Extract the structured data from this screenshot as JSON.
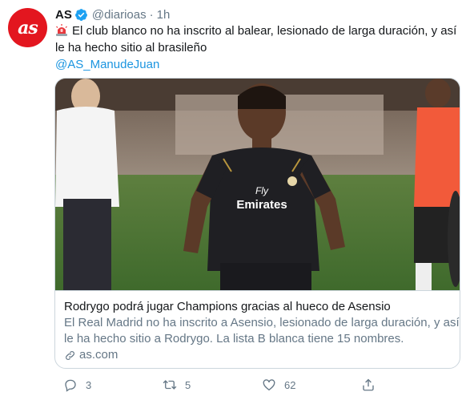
{
  "tweet": {
    "avatar_text": "as",
    "author_name": "AS",
    "handle": "@diarioas",
    "separator": "·",
    "time": "1h",
    "text_line1": "El club blanco no ha inscrito al balear, lesionado de larga duración, y así",
    "text_line2": "le ha hecho sitio al brasileño",
    "mention": "@AS_ManudeJuan",
    "icons": [
      "verified-badge-icon",
      "siren-emoji-icon"
    ],
    "colors": {
      "brand": "#e3161f",
      "verified": "#1da1f2",
      "link": "#1b95e0",
      "muted": "#657786"
    }
  },
  "card": {
    "image_jersey_text_line1": "Fly",
    "image_jersey_text_line2": "Emirates",
    "title": "Rodrygo podrá jugar Champions gracias al hueco de Asensio",
    "desc_line1": "El Real Madrid no ha inscrito a Asensio, lesionado de larga duración, y así",
    "desc_line2": "le ha hecho sitio a Rodrygo. La lista B blanca tiene 15 nombres.",
    "domain": "as.com"
  },
  "actions": {
    "reply_count": "3",
    "retweet_count": "5",
    "like_count": "62",
    "icons": [
      "reply-icon",
      "retweet-icon",
      "like-icon",
      "share-icon"
    ]
  }
}
